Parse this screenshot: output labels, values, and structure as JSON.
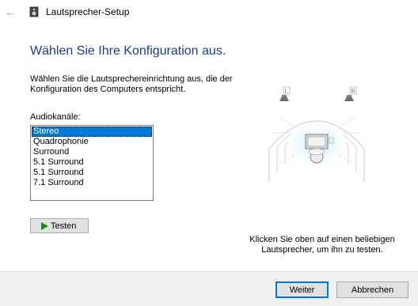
{
  "window": {
    "title": "Lautsprecher-Setup",
    "back_icon": "←"
  },
  "main": {
    "heading": "Wählen Sie Ihre Konfiguration aus.",
    "description": "Wählen Sie die Lautsprechereinrichtung aus, die der Konfiguration des Computers entspricht.",
    "audio_channels_label": "Audiokanäle:",
    "audio_channels": [
      "Stereo",
      "Quadrophonie",
      "Surround",
      "5.1 Surround",
      "5.1 Surround",
      "7.1 Surround"
    ],
    "selected_index": 0,
    "test_button_label": "Testen",
    "diagram": {
      "left_label": "L",
      "right_label": "R",
      "hint": "Klicken Sie oben auf einen beliebigen Lautsprecher, um ihn zu testen."
    }
  },
  "footer": {
    "next_label": "Weiter",
    "cancel_label": "Abbrechen"
  },
  "colors": {
    "heading": "#1a3d8f",
    "selection": "#0078d7",
    "play": "#1d8a1d",
    "footer_bg": "#f0f0f0"
  }
}
